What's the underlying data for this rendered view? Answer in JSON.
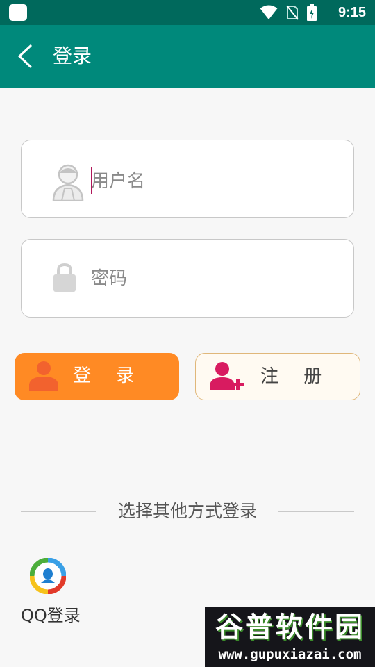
{
  "status_bar": {
    "time": "9:15",
    "icons": [
      "app-square-icon",
      "wifi-icon",
      "no-sim-icon",
      "battery-charging-icon"
    ]
  },
  "app_bar": {
    "title": "登录",
    "back_icon": "chevron-left-icon"
  },
  "form": {
    "username": {
      "placeholder": "用户名",
      "icon": "user-avatar-icon"
    },
    "password": {
      "placeholder": "密码",
      "icon": "lock-icon"
    }
  },
  "buttons": {
    "login": {
      "label": "登 录",
      "icon": "person-icon"
    },
    "register": {
      "label": "注 册",
      "icon": "add-person-icon"
    }
  },
  "other_login": {
    "divider_text": "选择其他方式登录",
    "qq": {
      "label": "QQ登录",
      "icon": "qq-logo-icon"
    }
  },
  "watermark": {
    "title": "谷普软件园",
    "url": "www.gupuxiazai.com"
  },
  "colors": {
    "status_bar": "#00695c",
    "app_bar": "#00897b",
    "login_button": "#ff8a24",
    "register_icon": "#d81b60",
    "caret": "#b0185a"
  }
}
